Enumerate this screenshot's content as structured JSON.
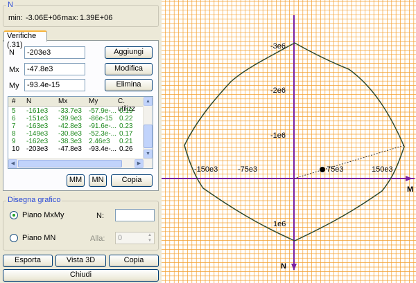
{
  "summary": {
    "legend": "N",
    "min_label": "min:",
    "min_value": "-3.06E+06",
    "max_label": "max:",
    "max_value": "1.39E+06"
  },
  "tab": {
    "label": "Verifiche (.31)"
  },
  "fields": {
    "n": {
      "label": "N",
      "value": "-203e3"
    },
    "mx": {
      "label": "Mx",
      "value": "-47.8e3"
    },
    "my": {
      "label": "My",
      "value": "-93.4e-15"
    }
  },
  "buttons": {
    "add": "Aggiungi",
    "edit": "Modifica",
    "delete": "Elimina",
    "mm": "MM",
    "mn": "MN",
    "copy_list": "Copia",
    "export": "Esporta",
    "view3d": "Vista 3D",
    "copy": "Copia",
    "close": "Chiudi"
  },
  "table": {
    "columns": [
      "#",
      "N",
      "Mx",
      "My",
      "C. utilizz"
    ],
    "rows": [
      [
        "5",
        "-161e3",
        "-33.7e3",
        "-57.9e-...",
        "0.19"
      ],
      [
        "6",
        "-151e3",
        "-39.9e3",
        "-86e-15",
        "0.22"
      ],
      [
        "7",
        "-163e3",
        "-42.8e3",
        "-91.6e-...",
        "0.23"
      ],
      [
        "8",
        "-149e3",
        "-30.8e3",
        "-52.3e-...",
        "0.17"
      ],
      [
        "9",
        "-162e3",
        "-38.3e3",
        "2.46e3",
        "0.21"
      ],
      [
        "10",
        "-203e3",
        "-47.8e3",
        "-93.4e-...",
        "0.26"
      ]
    ]
  },
  "draw": {
    "legend": "Disegna grafico",
    "radio_mxmy": "Piano MxMy",
    "radio_mn": "Piano MN",
    "n_label": "N:",
    "n_value": "",
    "alla_label": "Alla:",
    "alla_value": "0"
  },
  "plot": {
    "axis_h_label": "M",
    "axis_v_label": "N",
    "x_ticks": [
      "-150e3",
      "-75e3",
      "75e3",
      "150e3"
    ],
    "y_ticks": [
      "-3e6",
      "-2e6",
      "-1e6",
      "1e6"
    ],
    "colors": {
      "grid": "#f4a030",
      "h_axis": "#7a1fa2",
      "v_axis": "#7a1fa2",
      "domain": "#2f4a2f"
    }
  }
}
